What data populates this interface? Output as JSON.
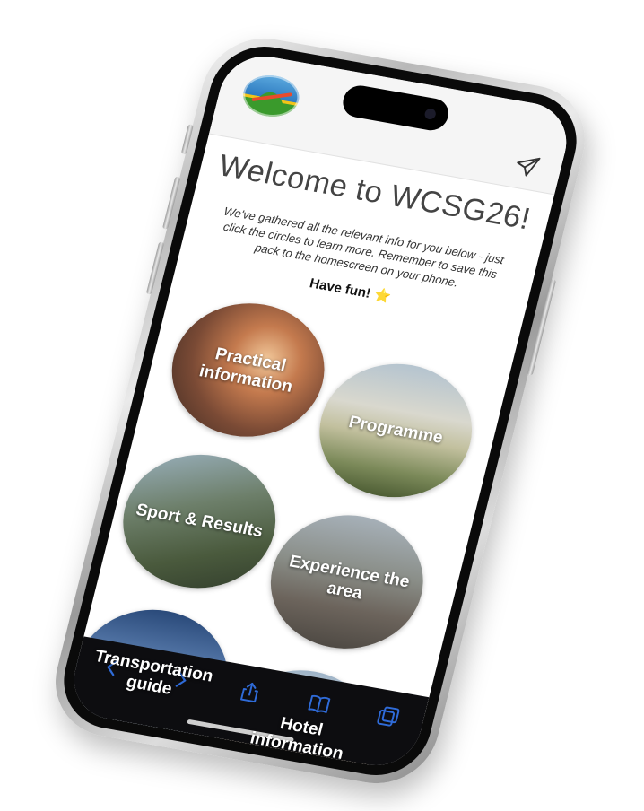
{
  "app": {
    "title": "Welcome to WCSG26!",
    "intro": "We've gathered all the relevant info for you below - just click the circles to learn more. Remember to save this pack to the homescreen on your phone.",
    "fun": "Have fun!",
    "fun_emoji": "⭐"
  },
  "tiles": [
    {
      "label": "Practical information"
    },
    {
      "label": "Programme"
    },
    {
      "label": "Sport & Results"
    },
    {
      "label": "Experience the area"
    },
    {
      "label": "Transportation guide"
    },
    {
      "label": "Hotel information"
    }
  ],
  "toolbar": {
    "items": [
      "back-icon",
      "forward-icon",
      "share-icon",
      "bookmarks-icon",
      "tabs-icon"
    ],
    "accent": "#2f6bd8"
  }
}
